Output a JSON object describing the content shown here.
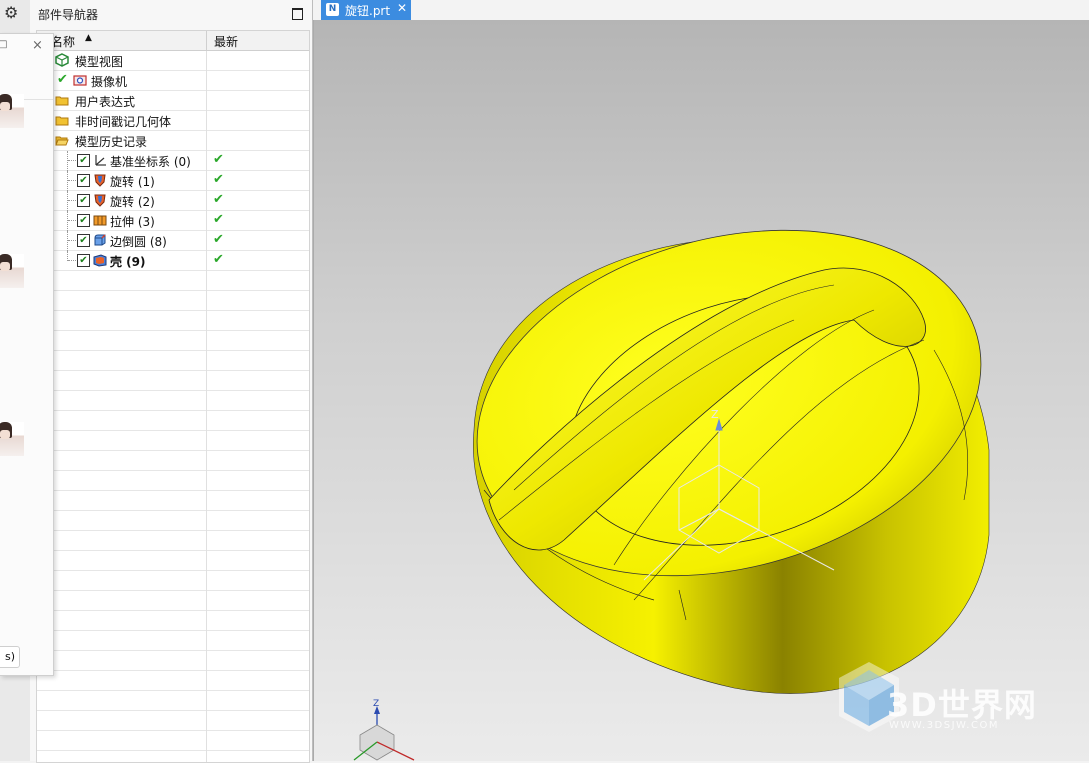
{
  "sidebar": {
    "settings_icon": "gear-icon"
  },
  "navigator": {
    "title": "部件导航器",
    "col_name": "名称",
    "col_latest": "最新",
    "sort_symbol": "▲",
    "rows": [
      {
        "label": "模型视图",
        "icon": "model-view-icon"
      },
      {
        "label": "摄像机",
        "icon": "camera-icon"
      },
      {
        "label": "用户表达式",
        "icon": "folder-icon"
      },
      {
        "label": "非时间戳记几何体",
        "icon": "folder-icon"
      },
      {
        "label": "模型历史记录",
        "icon": "folder-open-icon"
      }
    ],
    "features": [
      {
        "label": "基准坐标系 (0)",
        "icon": "datum-csys-icon",
        "checked": true,
        "latest": "✔"
      },
      {
        "label": "旋转 (1)",
        "icon": "revolve-icon",
        "checked": true,
        "latest": "✔"
      },
      {
        "label": "旋转 (2)",
        "icon": "revolve-icon",
        "checked": true,
        "latest": "✔"
      },
      {
        "label": "拉伸 (3)",
        "icon": "extrude-icon",
        "checked": true,
        "latest": "✔"
      },
      {
        "label": "边倒圆 (8)",
        "icon": "edge-blend-icon",
        "checked": true,
        "latest": "✔"
      },
      {
        "label": "壳 (9)",
        "icon": "shell-icon",
        "checked": true,
        "latest": "✔",
        "bold": true
      }
    ],
    "check_mark": "✔"
  },
  "float_panel": {
    "close_label": "×",
    "restore_label": "□",
    "button_label": "s)"
  },
  "tab": {
    "label": "旋钮.prt",
    "close_label": "✕",
    "icon_letter": "N"
  },
  "viewport": {
    "axis_label_z": "Z",
    "colors": {
      "model": "#f4f000",
      "background_top": "#b5b5b5"
    }
  },
  "watermark": {
    "text": "3D世界网",
    "url": "WWW.3DSJW.COM"
  }
}
